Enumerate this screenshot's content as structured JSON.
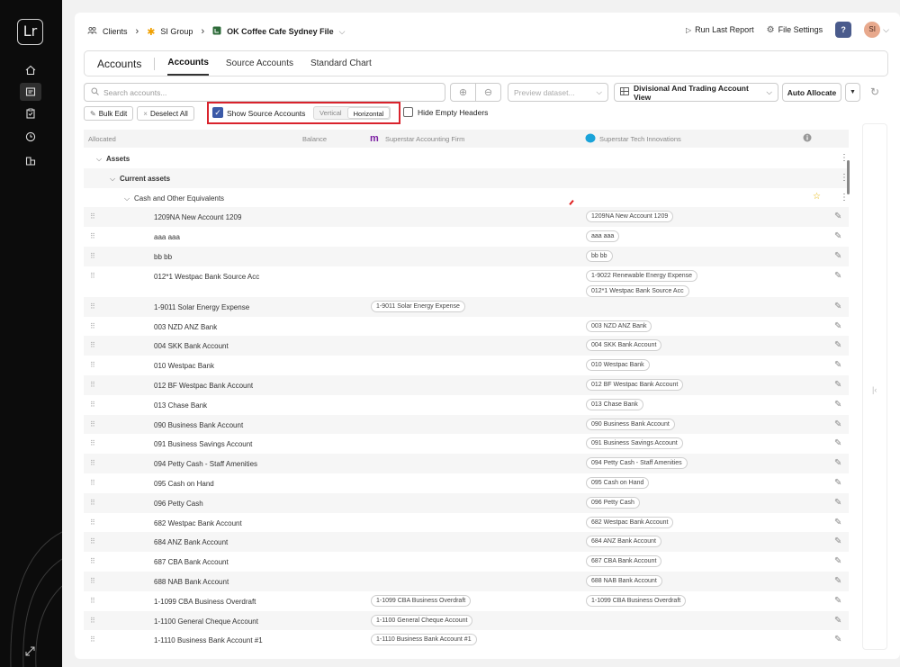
{
  "rail": {
    "logo": "Lr",
    "items": [
      "home-icon",
      "document-list-icon",
      "clipboard-check-icon",
      "clock-icon",
      "building-icon"
    ]
  },
  "breadcrumb": {
    "clients": "Clients",
    "group": "SI Group",
    "file": "OK Coffee Cafe Sydney File"
  },
  "topbar": {
    "run_last_report": "Run Last Report",
    "file_settings": "File Settings",
    "help": "?",
    "avatar": "SI"
  },
  "tabs": {
    "title": "Accounts",
    "items": [
      {
        "label": "Accounts",
        "active": true
      },
      {
        "label": "Source Accounts",
        "active": false
      },
      {
        "label": "Standard Chart",
        "active": false
      }
    ]
  },
  "toolbar": {
    "search_placeholder": "Search accounts...",
    "preview_placeholder": "Preview dataset...",
    "view": "Divisional And Trading Account View",
    "auto_allocate": "Auto Allocate"
  },
  "actions": {
    "bulk_edit": "Bulk Edit",
    "deselect_all": "Deselect All",
    "show_source_accounts": "Show Source Accounts",
    "vertical": "Vertical",
    "horizontal": "Horizontal",
    "hide_empty_headers": "Hide Empty Headers"
  },
  "table": {
    "headers": {
      "allocated": "Allocated",
      "balance": "Balance",
      "source1": "Superstar Accounting Firm",
      "source2": "Superstar Tech Innovations"
    },
    "colors": {
      "source1": "#7b1fa2",
      "source2": "#1aa3d9",
      "highlight": "#d9232d"
    },
    "groups": [
      {
        "label": "Assets",
        "level": 0
      },
      {
        "label": "Current assets",
        "level": 1
      },
      {
        "label": "Cash and Other Equivalents",
        "level": 2
      }
    ],
    "rows": [
      {
        "name": "1209NA New Account 1209",
        "src1": [],
        "src2": [
          "1209NA New Account 1209"
        ]
      },
      {
        "name": "aaa aaa",
        "src1": [],
        "src2": [
          "aaa aaa"
        ]
      },
      {
        "name": "bb bb",
        "src1": [],
        "src2": [
          "bb bb"
        ]
      },
      {
        "name": "012*1 Westpac Bank Source Acc",
        "src1": [],
        "src2": [
          "1-9022 Renewable Energy Expense",
          "012*1 Westpac Bank Source Acc"
        ]
      },
      {
        "name": "1-9011 Solar Energy Expense",
        "src1": [
          "1-9011 Solar Energy Expense"
        ],
        "src2": []
      },
      {
        "name": "003 NZD ANZ Bank",
        "src1": [],
        "src2": [
          "003 NZD ANZ Bank"
        ]
      },
      {
        "name": "004 SKK Bank Account",
        "src1": [],
        "src2": [
          "004 SKK Bank Account"
        ]
      },
      {
        "name": "010 Westpac Bank",
        "src1": [],
        "src2": [
          "010 Westpac Bank"
        ]
      },
      {
        "name": "012 BF Westpac Bank Account",
        "src1": [],
        "src2": [
          "012 BF Westpac Bank Account"
        ]
      },
      {
        "name": "013 Chase Bank",
        "src1": [],
        "src2": [
          "013 Chase Bank"
        ]
      },
      {
        "name": "090 Business Bank Account",
        "src1": [],
        "src2": [
          "090 Business Bank Account"
        ]
      },
      {
        "name": "091 Business Savings Account",
        "src1": [],
        "src2": [
          "091 Business Savings Account"
        ]
      },
      {
        "name": "094 Petty Cash - Staff Amenities",
        "src1": [],
        "src2": [
          "094 Petty Cash - Staff Amenities"
        ]
      },
      {
        "name": "095 Cash on Hand",
        "src1": [],
        "src2": [
          "095 Cash on Hand"
        ]
      },
      {
        "name": "096 Petty Cash",
        "src1": [],
        "src2": [
          "096 Petty Cash"
        ]
      },
      {
        "name": "682 Westpac Bank Account",
        "src1": [],
        "src2": [
          "682 Westpac Bank Account"
        ]
      },
      {
        "name": "684 ANZ Bank Account",
        "src1": [],
        "src2": [
          "684 ANZ Bank Account"
        ]
      },
      {
        "name": "687 CBA Bank Account",
        "src1": [],
        "src2": [
          "687 CBA Bank Account"
        ]
      },
      {
        "name": "688 NAB Bank Account",
        "src1": [],
        "src2": [
          "688 NAB Bank Account"
        ]
      },
      {
        "name": "1-1099 CBA Business Overdraft",
        "src1": [
          "1-1099 CBA Business Overdraft"
        ],
        "src2": [
          "1-1099 CBA Business Overdraft"
        ]
      },
      {
        "name": "1-1100 General Cheque Account",
        "src1": [
          "1-1100 General Cheque Account"
        ],
        "src2": []
      },
      {
        "name": "1-1110 Business Bank Account #1",
        "src1": [
          "1-1110 Business Bank Account #1"
        ],
        "src2": []
      }
    ]
  }
}
